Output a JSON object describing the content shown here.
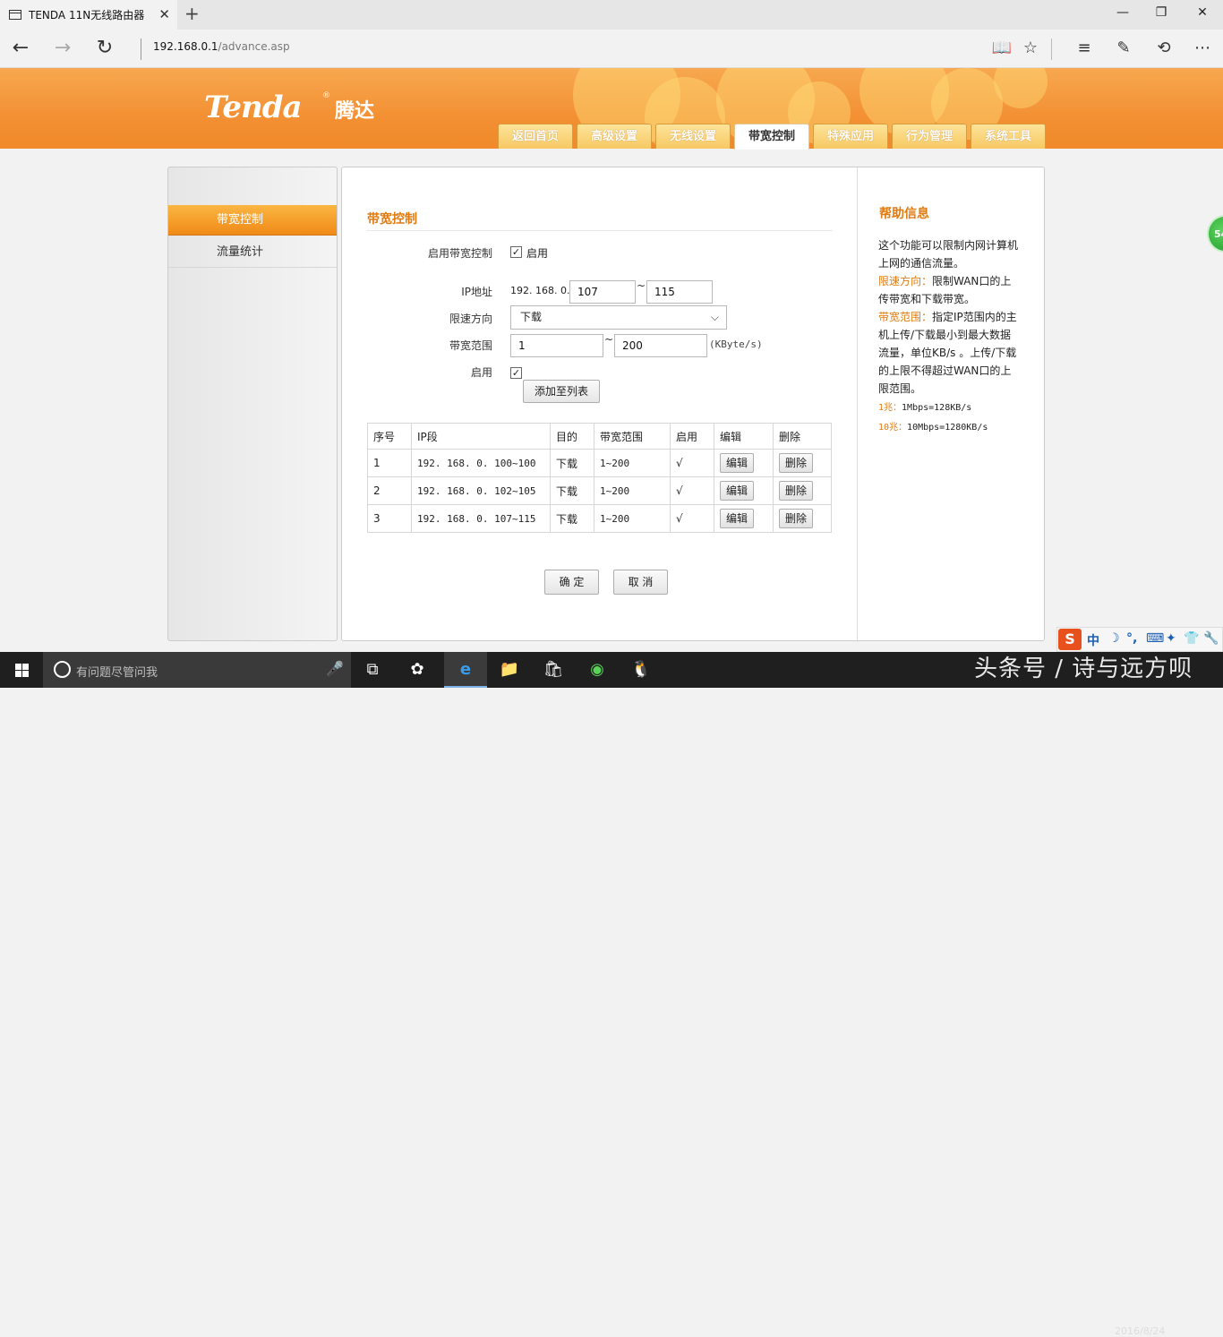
{
  "browser": {
    "tab_title": "TENDA 11N无线路由器",
    "tab_close": "✕",
    "new_tab": "+",
    "win_min": "—",
    "win_max": "❐",
    "win_close": "✕",
    "back": "←",
    "forward": "→",
    "refresh": "↻",
    "url_host": "192.168.0.1",
    "url_path": "/advance.asp",
    "toolbar": {
      "reading": "📖",
      "favorite": "☆",
      "hub": "≡",
      "note": "✎",
      "share": "⟲",
      "more": "⋯"
    }
  },
  "brand": {
    "logo": "Tenda",
    "registered": "®",
    "logo_cn": "腾达"
  },
  "nav": {
    "tabs": [
      "返回首页",
      "高级设置",
      "无线设置",
      "带宽控制",
      "特殊应用",
      "行为管理",
      "系统工具"
    ],
    "active_index": 3
  },
  "sidebar": {
    "items": [
      "带宽控制",
      "流量统计"
    ],
    "active_index": 0
  },
  "form": {
    "section_title": "带宽控制",
    "enable_label": "启用带宽控制",
    "enable_checkbox": "✓",
    "enable_text": "启用",
    "ip_label": "IP地址",
    "ip_prefix": "192. 168. 0.",
    "ip_start": "107",
    "ip_end": "115",
    "tilde": "~",
    "direction_label": "限速方向",
    "direction_value": "下载",
    "direction_chevron": "⌵",
    "range_label": "带宽范围",
    "range_min": "1",
    "range_max": "200",
    "unit": "(KByte/s)",
    "enable2_label": "启用",
    "enable2_checkbox": "✓",
    "add_button": "添加至列表",
    "confirm_button": "确 定",
    "cancel_button": "取 消"
  },
  "table": {
    "headers": [
      "序号",
      "IP段",
      "目的",
      "带宽范围",
      "启用",
      "编辑",
      "删除"
    ],
    "rows": [
      {
        "index": "1",
        "ip": "192. 168. 0. 100~100",
        "direction": "下载",
        "range": "1~200",
        "enabled": "√",
        "edit": "编辑",
        "delete": "删除"
      },
      {
        "index": "2",
        "ip": "192. 168. 0. 102~105",
        "direction": "下载",
        "range": "1~200",
        "enabled": "√",
        "edit": "编辑",
        "delete": "删除"
      },
      {
        "index": "3",
        "ip": "192. 168. 0. 107~115",
        "direction": "下载",
        "range": "1~200",
        "enabled": "√",
        "edit": "编辑",
        "delete": "删除"
      }
    ]
  },
  "help": {
    "title": "帮助信息",
    "intro": "这个功能可以限制内网计算机上网的通信流量。",
    "dir_term": "限速方向：",
    "dir_text": "限制WAN口的上传带宽和下载带宽。",
    "range_term": "带宽范围：",
    "range_text": "指定IP范围内的主机上传/下载最小到最大数据流量，单位KB/s 。上传/下载的上限不得超过WAN口的上限范围。",
    "note1_term": "1兆：",
    "note1_text": "1Mbps=128KB/s",
    "note2_term": "10兆：",
    "note2_text": "10Mbps=1280KB/s"
  },
  "floating_badge": "54",
  "taskbar": {
    "search_placeholder": "有问题尽管问我",
    "mic": "🎤",
    "apps": [
      "⧉",
      "✿",
      "e",
      "📁",
      "🛍",
      "◉",
      "🐧"
    ],
    "tray_s": "S",
    "tray_items": [
      "中",
      "☽",
      "°,",
      "⌨",
      "✦",
      "👕",
      "🔧"
    ],
    "watermark": "头条号 / 诗与远方呗",
    "date": "2016/8/24"
  }
}
